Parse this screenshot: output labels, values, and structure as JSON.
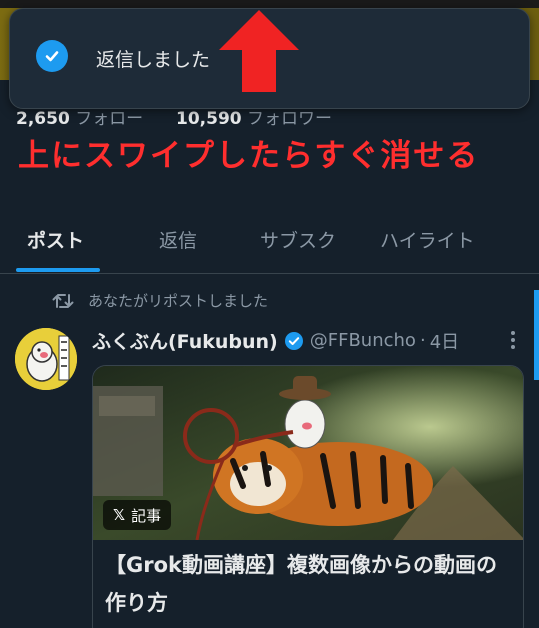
{
  "toast": {
    "message": "返信しました",
    "icon": "check-circle-icon"
  },
  "overlay": {
    "arrow": "up-arrow-icon",
    "caption": "上にスワイプしたらすぐ消せる",
    "caption_color": "#ff2e2e"
  },
  "profile": {
    "following_count": "2,650",
    "following_label": "フォロー",
    "followers_count": "10,590",
    "followers_label": "フォロワー"
  },
  "tabs": [
    {
      "label": "ポスト",
      "active": true
    },
    {
      "label": "返信",
      "active": false
    },
    {
      "label": "サブスク",
      "active": false
    },
    {
      "label": "ハイライト",
      "active": false
    }
  ],
  "post": {
    "repost_label": "あなたがリポストしました",
    "author_name": "ふくぶん(Fukubun)",
    "verified": true,
    "handle": "@FFBuncho",
    "separator": "·",
    "time": "4日",
    "card": {
      "badge": "記事",
      "title": "【Grok動画講座】複数画像からの動画の作り方"
    }
  },
  "colors": {
    "background": "#15202b",
    "accent": "#1d9bf0",
    "text_primary": "#e7e9ea",
    "text_secondary": "#8b98a5"
  }
}
